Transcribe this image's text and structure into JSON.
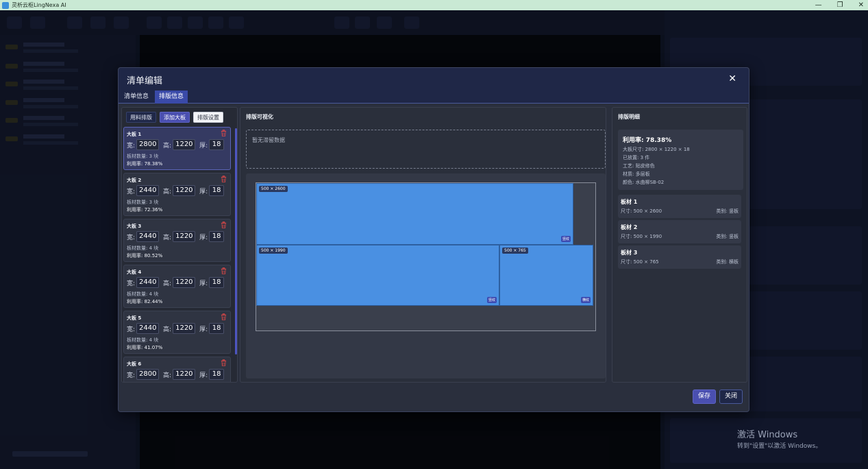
{
  "window": {
    "title": "灵析云枢LingNexa AI"
  },
  "modal": {
    "title": "清单编辑",
    "tabs": [
      {
        "label": "清单信息",
        "active": false
      },
      {
        "label": "排版信息",
        "active": true
      }
    ],
    "left": {
      "actions": {
        "use_material": "用料排版",
        "add_slab": "添加大板",
        "layout_settings": "排版设置"
      },
      "dim_labels": {
        "width": "宽:",
        "height": "高:",
        "thickness": "厚:"
      },
      "slabs": [
        {
          "name": "大板 1",
          "width": "2800",
          "height": "1220",
          "thickness": "18",
          "count": "板材数量: 3 块",
          "utilization": "利用率: 78.38%",
          "selected": true
        },
        {
          "name": "大板 2",
          "width": "2440",
          "height": "1220",
          "thickness": "18",
          "count": "板材数量: 3 块",
          "utilization": "利用率: 72.36%",
          "selected": false
        },
        {
          "name": "大板 3",
          "width": "2440",
          "height": "1220",
          "thickness": "18",
          "count": "板材数量: 4 块",
          "utilization": "利用率: 80.52%",
          "selected": false
        },
        {
          "name": "大板 4",
          "width": "2440",
          "height": "1220",
          "thickness": "18",
          "count": "板材数量: 4 块",
          "utilization": "利用率: 82.44%",
          "selected": false
        },
        {
          "name": "大板 5",
          "width": "2440",
          "height": "1220",
          "thickness": "18",
          "count": "板材数量: 4 块",
          "utilization": "利用率: 41.07%",
          "selected": false
        },
        {
          "name": "大板 6",
          "width": "2800",
          "height": "1220",
          "thickness": "18",
          "count": "",
          "utilization": "",
          "selected": false
        }
      ]
    },
    "middle": {
      "title": "排版可视化",
      "empty_text": "暂无滞留数据",
      "pieces": [
        {
          "label": "500 × 2600",
          "tag": "竖纹"
        },
        {
          "label": "500 × 1990",
          "tag": "竖纹"
        },
        {
          "label": "500 × 765",
          "tag": "横纹"
        }
      ]
    },
    "right": {
      "title": "排版明细",
      "summary": {
        "utilization": "利用率: 78.38%",
        "lines": [
          "大板尺寸: 2800 × 1220 × 18",
          "已放置: 3 件",
          "工艺: 贴皮修色",
          "材质: 多层板",
          "颜色: 水曲柳SB-02"
        ]
      },
      "pieces": [
        {
          "name": "板材 1",
          "size": "尺寸: 500 × 2600",
          "category": "类别: 竖板"
        },
        {
          "name": "板材 2",
          "size": "尺寸: 500 × 1990",
          "category": "类别: 竖板"
        },
        {
          "name": "板材 3",
          "size": "尺寸: 500 × 765",
          "category": "类别: 横板"
        }
      ]
    },
    "footer": {
      "save": "保存",
      "close": "关闭"
    }
  },
  "watermark": {
    "line1": "激活 Windows",
    "line2": "转到\"设置\"以激活 Windows。"
  },
  "colors": {
    "accent": "#4a4fb0",
    "piece_fill": "#4a90e2",
    "header": "#1f2747"
  }
}
